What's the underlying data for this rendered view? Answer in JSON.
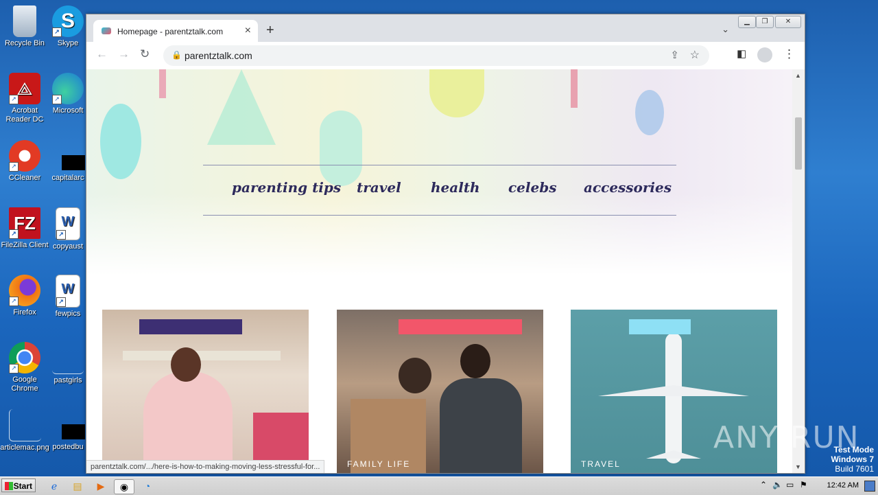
{
  "desktop": {
    "icons": [
      {
        "label": "Recycle Bin",
        "color": "#b7c7d8"
      },
      {
        "label": "Skype",
        "color": "#1a9ce0"
      },
      {
        "label": "Acrobat Reader DC",
        "color": "#c81818"
      },
      {
        "label": "Microsoft",
        "color": "#1b7ad8"
      },
      {
        "label": "CCleaner",
        "color": "#e23a24"
      },
      {
        "label": "capitalarc",
        "color": "#000000"
      },
      {
        "label": "FileZilla Client",
        "color": "#c1121f"
      },
      {
        "label": "copyaust",
        "color": "#2b5fb0"
      },
      {
        "label": "Firefox",
        "color": "#f07414"
      },
      {
        "label": "fewpics",
        "color": "#2b5fb0"
      },
      {
        "label": "Google Chrome",
        "color": "#2e8b57"
      },
      {
        "label": "pastgirls",
        "color": "#3a78c8"
      },
      {
        "label": "articlemac.png",
        "color": "#3a78c8"
      },
      {
        "label": "postedbu",
        "color": "#000000"
      }
    ]
  },
  "browser": {
    "tab_title": "Homepage - parentztalk.com",
    "url": "parentztalk.com",
    "status_url": "parentztalk.com/.../here-is-how-to-making-moving-less-stressful-for..."
  },
  "site": {
    "nav": [
      "parenting tips",
      "travel",
      "health",
      "celebs",
      "accessories"
    ],
    "cards": [
      {
        "category": "",
        "bar_color": "#3d2f73",
        "image_desc": "girl-on-bunk-bed"
      },
      {
        "category": "FAMILY LIFE",
        "bar_color": "#f2566a",
        "image_desc": "family-moving-boxes"
      },
      {
        "category": "TRAVEL",
        "bar_color": "#8ee0f5",
        "image_desc": "airplane-sky"
      }
    ]
  },
  "watermark": "ANY RUN",
  "os": {
    "test_mode": "Test Mode",
    "version": "Windows 7",
    "build": "Build 7601",
    "clock": "12:42 AM",
    "start_label": "Start"
  }
}
